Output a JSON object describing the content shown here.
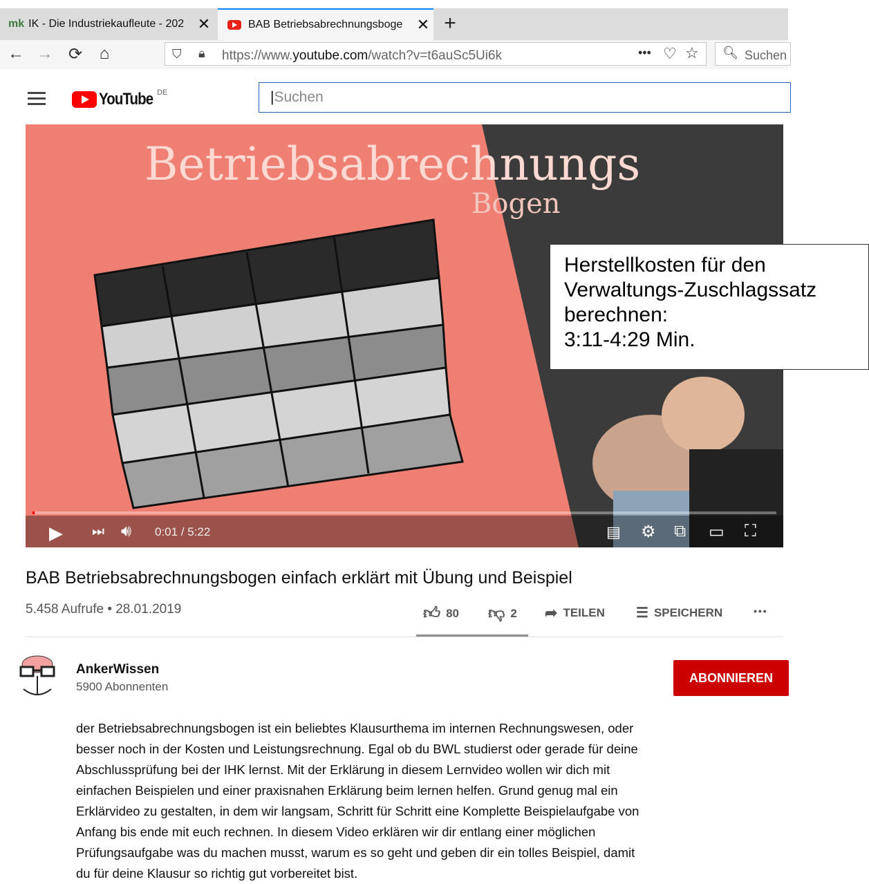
{
  "browser": {
    "tabs": [
      {
        "favicon": "mk",
        "title": "IK - Die Industriekaufleute - 202"
      },
      {
        "favicon": "youtube-icon",
        "title": "BAB Betriebsabrechnungsboge"
      }
    ],
    "url_prefix": "https://www.",
    "url_domain": "youtube.com",
    "url_path": "/watch?v=t6auSc5Ui6k",
    "search_placeholder": "Suchen",
    "overflow": "•••"
  },
  "youtube": {
    "logo_text": "YouTube",
    "region": "DE",
    "search_placeholder": "Suchen"
  },
  "video": {
    "thumb_title": "Betriebsabrechnungs",
    "thumb_subtitle": "Bogen",
    "time": "0:01 / 5:22",
    "progress": 0.003,
    "annotation": [
      "Herstellkosten für den",
      "Verwaltungs-Zuschlagssatz",
      "berechnen:",
      "3:11-4:29 Min."
    ]
  },
  "info": {
    "title": "BAB Betriebsabrechnungsbogen einfach erklärt mit Übung und Beispiel",
    "meta": "5.458 Aufrufe • 28.01.2019",
    "likes": "80",
    "dislikes": "2",
    "share": "TEILEN",
    "save": "SPEICHERN",
    "more": "•••"
  },
  "channel": {
    "name": "AnkerWissen",
    "subscribers": "5900 Abonnenten",
    "subscribe_label": "ABONNIEREN"
  },
  "description": [
    "der Betriebsabrechnungsbogen ist ein beliebtes Klausurthema im internen Rechnungswesen, oder",
    "besser noch in der Kosten und Leistungsrechnung. Egal ob du BWL studierst oder gerade für deine",
    "Abschlussprüfung bei der IHK lernst. Mit der Erklärung in diesem Lernvideo wollen wir dich mit",
    "einfachen Beispielen und einer praxisnahen Erklärung beim lernen helfen. Grund genug mal ein",
    "Erklärvideo zu gestalten, in dem wir langsam, Schritt für Schritt eine Komplette Beispielaufgabe von",
    "Anfang bis ende mit euch rechnen. In diesem Video erklären wir dir entlang einer möglichen",
    "Prüfungsaufgabe was du machen musst, warum es so geht und geben dir ein tolles Beispiel, damit",
    "du für deine Klausur so richtig gut vorbereitet bist."
  ],
  "colors": {
    "accent": "#cc0000",
    "video_bg": "#ef7f72",
    "chalkboard": "#3b3b3b"
  }
}
